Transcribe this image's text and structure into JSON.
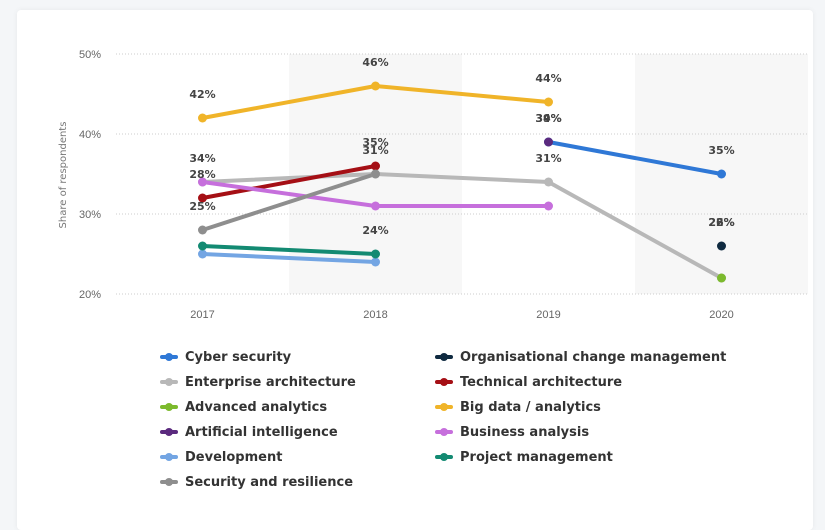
{
  "chart_data": {
    "type": "line",
    "title": "",
    "xlabel": "",
    "ylabel": "Share of respondents",
    "x": [
      "2017",
      "2018",
      "2019",
      "2020"
    ],
    "ylim": [
      20,
      50
    ],
    "yticks": [
      "20%",
      "30%",
      "40%",
      "50%"
    ],
    "grid": true,
    "legend_position": "bottom",
    "series": [
      {
        "name": "Cyber security",
        "color": "#2f78d6",
        "values": [
          null,
          null,
          39,
          35
        ]
      },
      {
        "name": "Organisational change management",
        "color": "#0f2a40",
        "values": [
          null,
          null,
          null,
          26
        ]
      },
      {
        "name": "Enterprise architecture",
        "color": "#b8b8b8",
        "values": [
          34,
          35,
          34,
          22
        ]
      },
      {
        "name": "Technical architecture",
        "color": "#a50f15",
        "values": [
          32,
          36,
          null,
          null
        ]
      },
      {
        "name": "Advanced analytics",
        "color": "#7cba2d",
        "values": [
          null,
          null,
          null,
          22
        ]
      },
      {
        "name": "Big data / analytics",
        "color": "#f0b429",
        "values": [
          42,
          46,
          44,
          null
        ]
      },
      {
        "name": "Artificial intelligence",
        "color": "#5b2a7e",
        "values": [
          null,
          null,
          39,
          null
        ]
      },
      {
        "name": "Business analysis",
        "color": "#c66fdc",
        "values": [
          34,
          31,
          31,
          null
        ]
      },
      {
        "name": "Development",
        "color": "#73a5e3",
        "values": [
          25,
          24,
          null,
          null
        ]
      },
      {
        "name": "Project management",
        "color": "#138a72",
        "values": [
          26,
          25,
          null,
          null
        ]
      },
      {
        "name": "Security and resilience",
        "color": "#8e8e8e",
        "values": [
          28,
          35,
          null,
          null
        ]
      }
    ],
    "data_labels": [
      {
        "x": "2017",
        "text": "42%",
        "anchor": 42
      },
      {
        "x": "2017",
        "text": "34%",
        "anchor": 34
      },
      {
        "x": "2017",
        "text": "28%",
        "anchor": 32
      },
      {
        "x": "2017",
        "text": "25%",
        "anchor": 28
      },
      {
        "x": "2018",
        "text": "46%",
        "anchor": 46
      },
      {
        "x": "2018",
        "text": "35%",
        "anchor": 36
      },
      {
        "x": "2018",
        "text": "31%",
        "anchor": 35
      },
      {
        "x": "2018",
        "text": "24%",
        "anchor": 25
      },
      {
        "x": "2019",
        "text": "44%",
        "anchor": 44
      },
      {
        "x": "2019",
        "text": "39%",
        "anchor": 39
      },
      {
        "x": "2019",
        "text": "34%",
        "anchor": 39
      },
      {
        "x": "2019",
        "text": "31%",
        "anchor": 34
      },
      {
        "x": "2020",
        "text": "35%",
        "anchor": 35
      },
      {
        "x": "2020",
        "text": "26%",
        "anchor": 26
      },
      {
        "x": "2020",
        "text": "22%",
        "anchor": 26
      }
    ]
  },
  "legend_order": [
    "Cyber security",
    "Organisational change management",
    "Enterprise architecture",
    "Technical architecture",
    "Advanced analytics",
    "Big data / analytics",
    "Artificial intelligence",
    "Business analysis",
    "Development",
    "Project management",
    "Security and resilience"
  ]
}
